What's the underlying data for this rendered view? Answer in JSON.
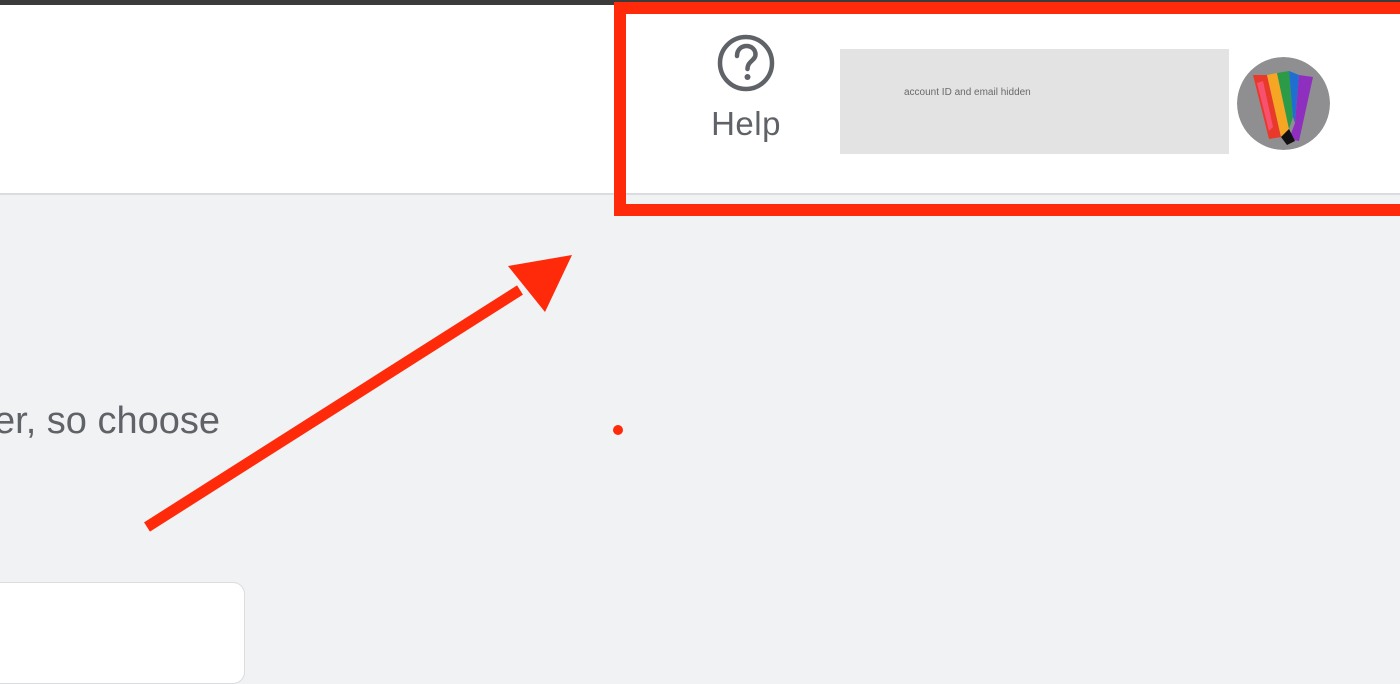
{
  "header": {
    "help": {
      "icon": "help-circle-icon",
      "label": "Help"
    },
    "account": {
      "redaction_text": "account ID and email hidden",
      "avatar_icon": "rainbow-w-avatar-icon"
    }
  },
  "main": {
    "description_fragment": "er, so choose"
  },
  "annotation": {
    "highlight_color": "#ff2a0a",
    "arrow_icon": "pointer-arrow-icon"
  }
}
